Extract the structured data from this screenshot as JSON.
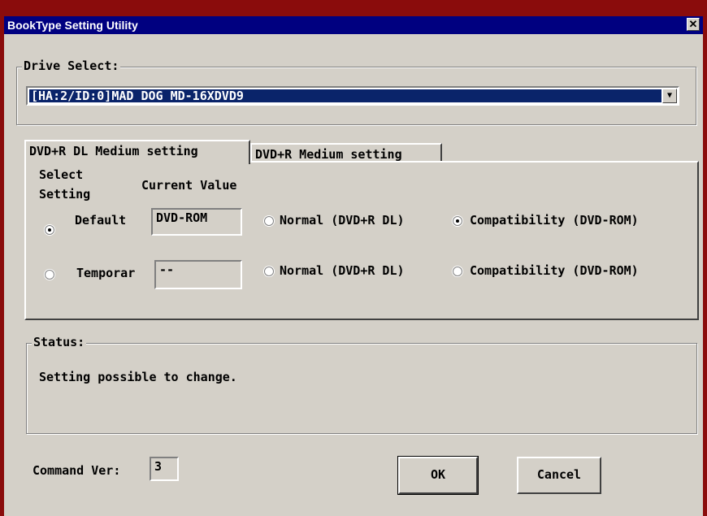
{
  "window": {
    "title": "BookType Setting Utility",
    "close_glyph": "✕"
  },
  "drive_select": {
    "label": "Drive Select:",
    "selected": "[HA:2/ID:0]MAD DOG MD-16XDVD9",
    "dropdown_glyph": "▼"
  },
  "tabs": [
    {
      "label": "DVD+R DL Medium setting",
      "active": true
    },
    {
      "label": "DVD+R Medium setting",
      "active": false
    }
  ],
  "panel": {
    "select_setting_header_line1": "Select",
    "select_setting_header_line2": "Setting",
    "current_value_header": "Current Value",
    "rows": [
      {
        "label": "Default",
        "selected": true,
        "current_value": "DVD-ROM",
        "option_normal": "Normal (DVD+R DL)",
        "option_compat": "Compatibility (DVD-ROM)",
        "choice": "compatibility"
      },
      {
        "label": "Temporar",
        "selected": false,
        "current_value": "--",
        "option_normal": "Normal (DVD+R DL)",
        "option_compat": "Compatibility (DVD-ROM)",
        "choice": "none"
      }
    ]
  },
  "status": {
    "label": "Status:",
    "message": "Setting possible to change."
  },
  "command_ver": {
    "label": "Command Ver:",
    "value": "3"
  },
  "buttons": {
    "ok": "OK",
    "cancel": "Cancel"
  },
  "colors": {
    "titlebar": "#000080",
    "face": "#d4d0c8",
    "frame": "#8a0c0c",
    "selection": "#0a246a"
  }
}
